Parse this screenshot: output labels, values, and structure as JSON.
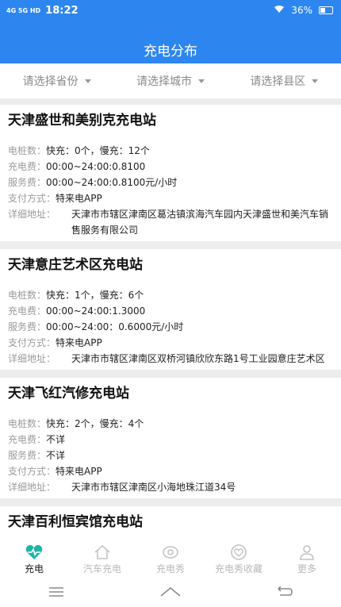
{
  "status_bar": {
    "signal": "4G 5G HD",
    "time": "18:22",
    "battery": "36%"
  },
  "header": {
    "title": "充电分布"
  },
  "filters": [
    {
      "label": "请选择省份"
    },
    {
      "label": "请选择城市"
    },
    {
      "label": "请选择县区"
    }
  ],
  "stations": [
    {
      "name": "天津盛世和美别克充电站",
      "piles_label": "电桩数：",
      "piles": "快充：0个，慢充：12个",
      "fee_label": "充电费：",
      "fee": "00:00~24:00:0.8100",
      "service_label": "服务费：",
      "service": "00:00~24:00:0.8100元/小时",
      "pay_label": "支付方式：",
      "pay": "特来电APP",
      "addr_label": "详细地址：",
      "addr": "天津市市辖区津南区葛沽镇滨海汽车园内天津盛世和美汽车销售服务有限公司"
    },
    {
      "name": "天津意庄艺术区充电站",
      "piles_label": "电桩数：",
      "piles": "快充：1个，慢充：6个",
      "fee_label": "充电费：",
      "fee": "00:00~24:00:1.3000",
      "service_label": "服务费：",
      "service": "00:00~24:00：0.6000元/小时",
      "pay_label": "支付方式：",
      "pay": "特来电APP",
      "addr_label": "详细地址：",
      "addr": "天津市市辖区津南区双桥河镇欣欣东路1号工业园意庄艺术区"
    },
    {
      "name": "天津飞红汽修充电站",
      "piles_label": "电桩数：",
      "piles": "快充：2个，慢充：4个",
      "fee_label": "充电费：",
      "fee": "不详",
      "service_label": "服务费：",
      "service": "不详",
      "pay_label": "支付方式：",
      "pay": "特来电APP",
      "addr_label": "详细地址：",
      "addr": "天津市市辖区津南区小海地珠江道34号"
    },
    {
      "name": "天津百利恒宾馆充电站"
    }
  ],
  "tabs": [
    {
      "label": "充电",
      "icon": "heart-pulse-icon",
      "active": true
    },
    {
      "label": "汽车充电",
      "icon": "house-icon",
      "active": false
    },
    {
      "label": "充电秀",
      "icon": "eye-icon",
      "active": false
    },
    {
      "label": "充电秀收藏",
      "icon": "heart-icon",
      "active": false
    },
    {
      "label": "更多",
      "icon": "user-icon",
      "active": false
    }
  ],
  "colors": {
    "primary": "#2d86f0",
    "active_tab_icon": "#1fb4a6"
  }
}
